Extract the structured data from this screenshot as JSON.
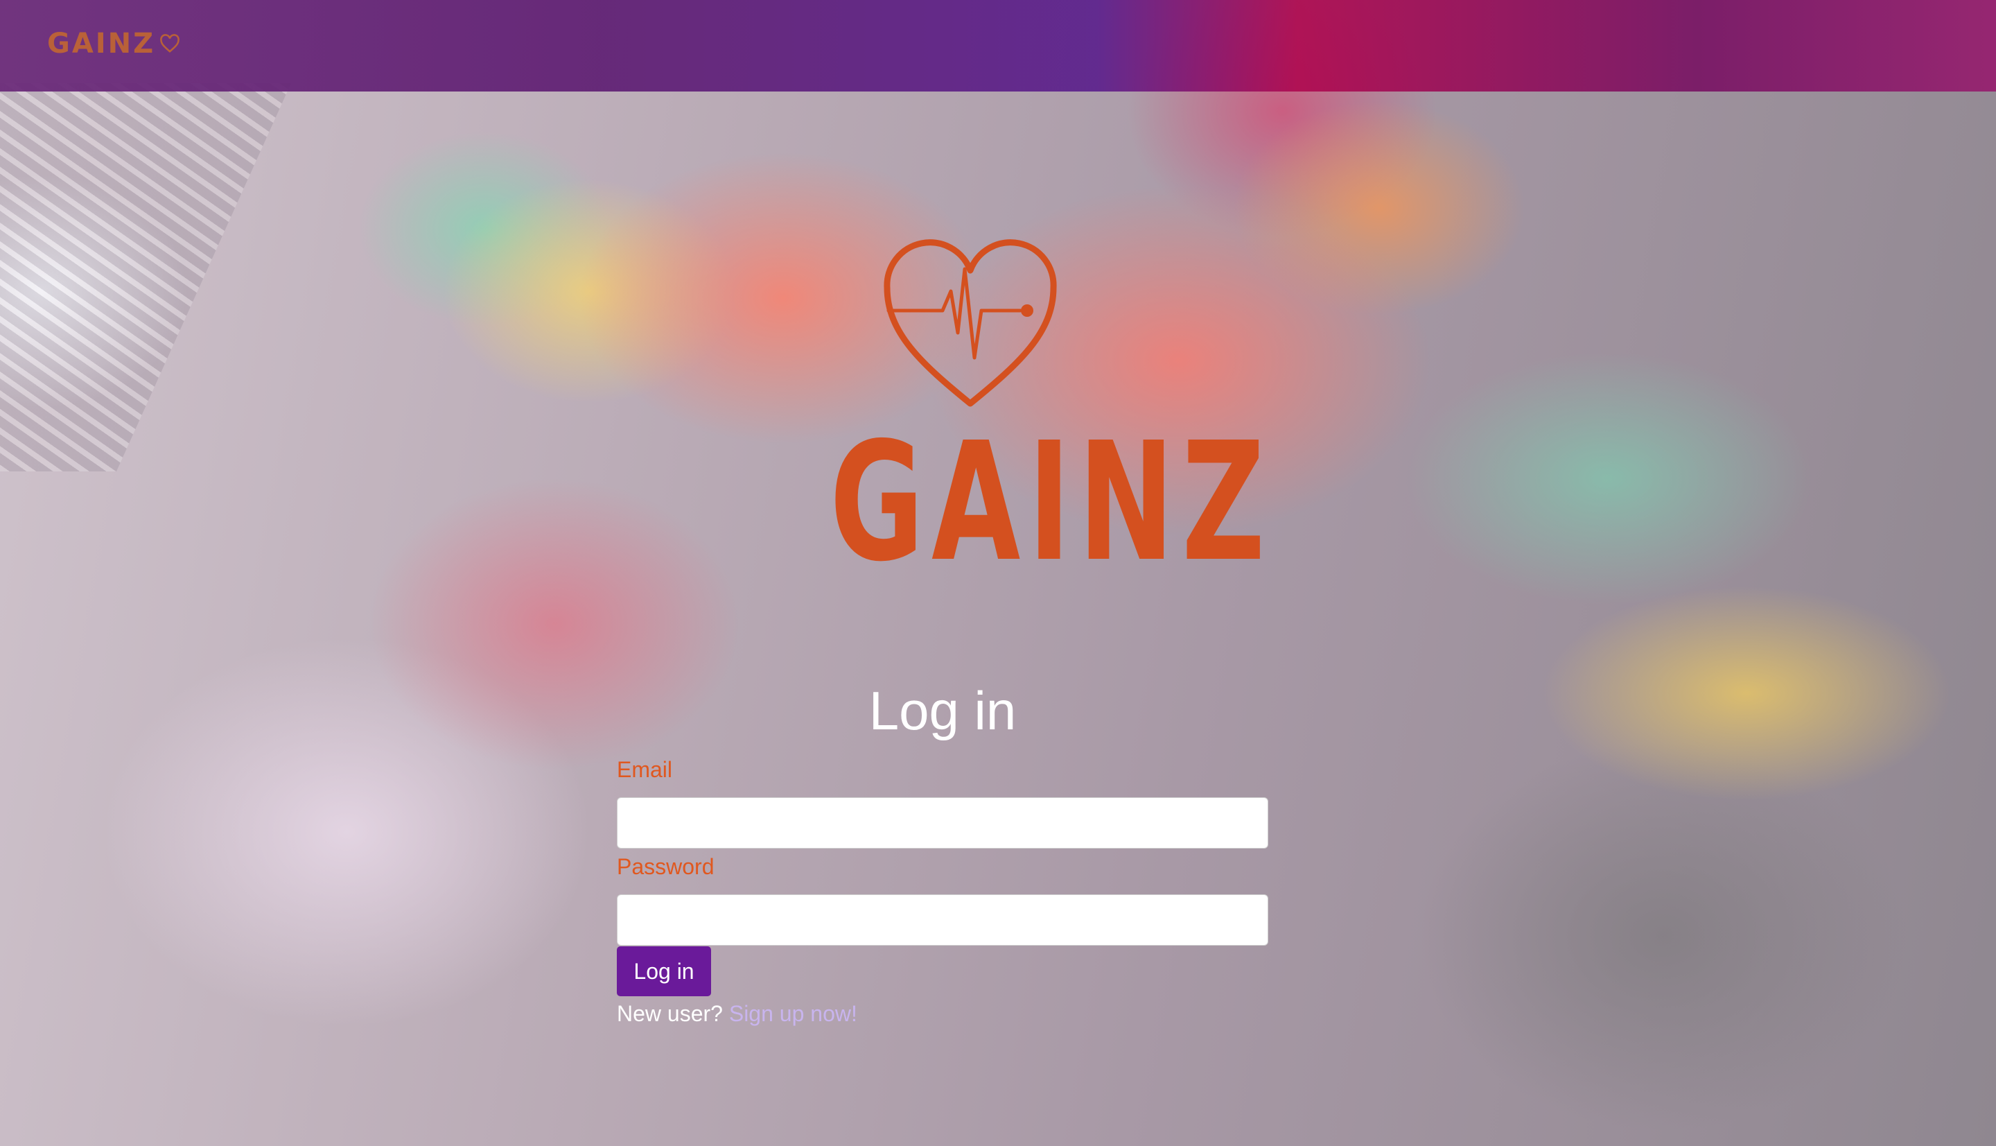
{
  "navbar": {
    "brand_text": "GAINZ",
    "brand_icon": "heart-icon"
  },
  "logo": {
    "text": "GAINZ",
    "icon": "heart-heartbeat-icon",
    "color": "#d4501f"
  },
  "form": {
    "title": "Log in",
    "email_label": "Email",
    "email_value": "",
    "password_label": "Password",
    "password_value": "",
    "submit_label": "Log in",
    "signup_prompt": "New user?",
    "signup_link": "Sign up now!"
  },
  "colors": {
    "accent": "#6a1a9a",
    "label": "#e0581f",
    "link": "#c8b4ee"
  }
}
